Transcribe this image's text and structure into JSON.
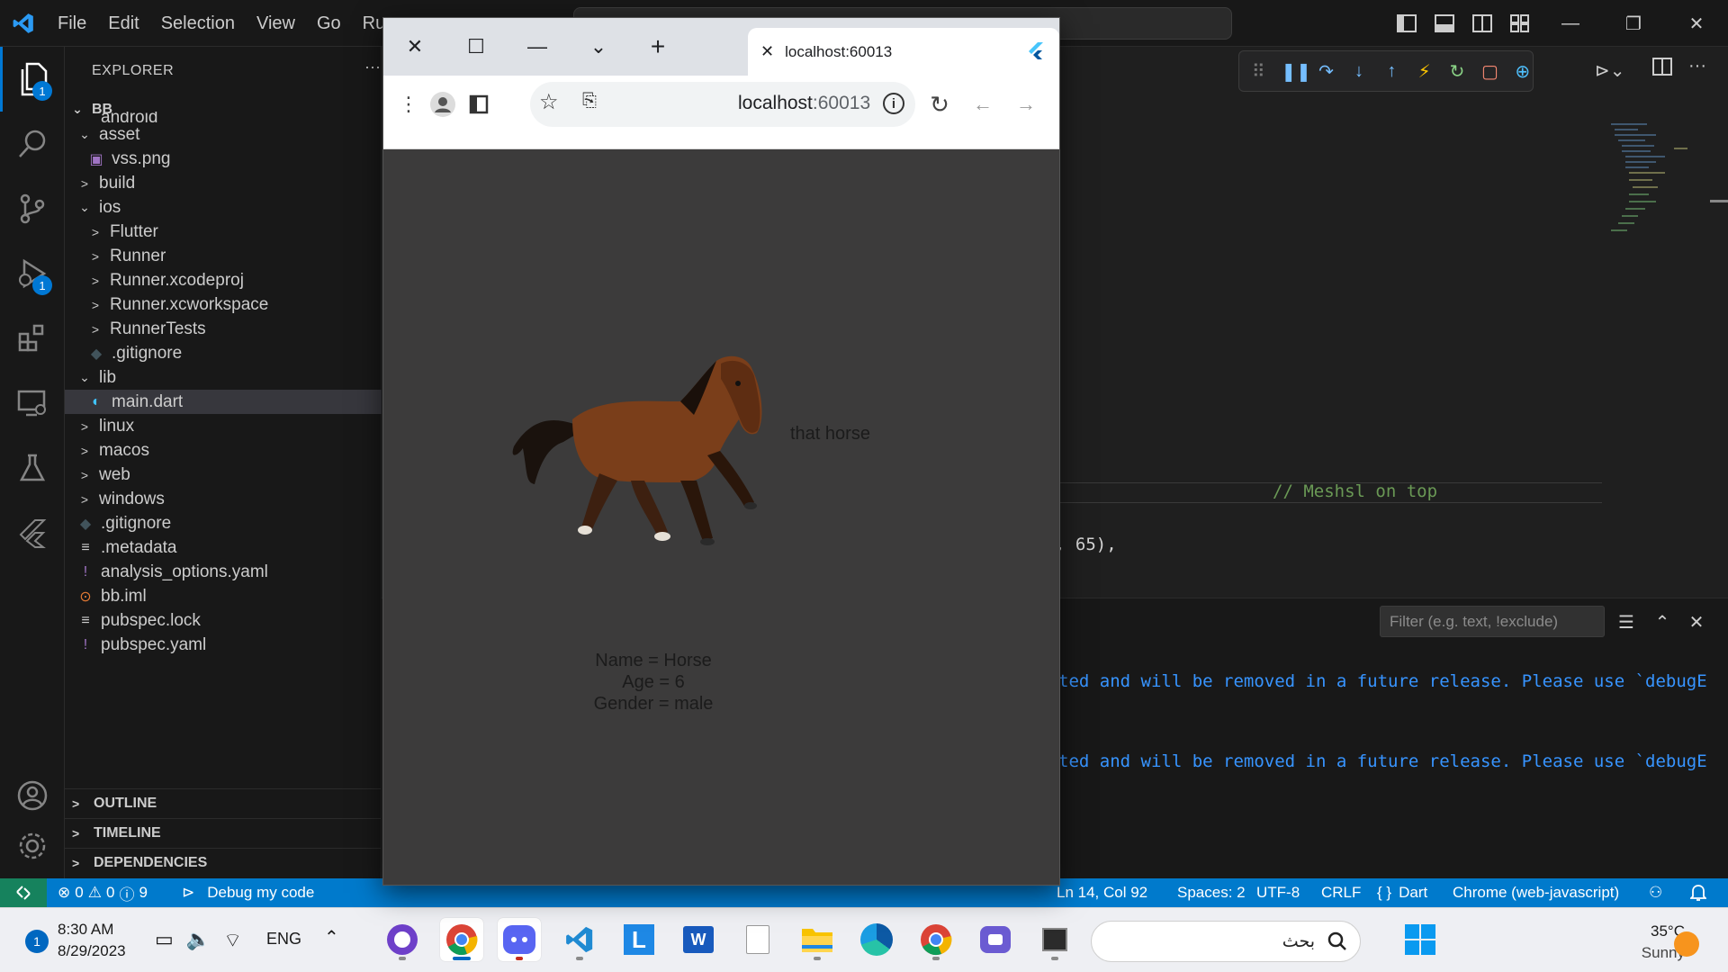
{
  "titlebar": {
    "menu": [
      "File",
      "Edit",
      "Selection",
      "View",
      "Go",
      "Run"
    ]
  },
  "activity": {
    "explorer_badge": "1",
    "debug_badge": "1"
  },
  "explorer": {
    "title": "EXPLORER",
    "more": "···",
    "root": "BB",
    "partial_item": "android",
    "items": [
      {
        "label": "asset",
        "kind": "folder-open",
        "depth": 1
      },
      {
        "label": "vss.png",
        "kind": "image",
        "depth": 2
      },
      {
        "label": "build",
        "kind": "folder",
        "depth": 1
      },
      {
        "label": "ios",
        "kind": "folder-open",
        "depth": 1
      },
      {
        "label": "Flutter",
        "kind": "folder",
        "depth": 2
      },
      {
        "label": "Runner",
        "kind": "folder",
        "depth": 2
      },
      {
        "label": "Runner.xcodeproj",
        "kind": "folder",
        "depth": 2
      },
      {
        "label": "Runner.xcworkspace",
        "kind": "folder",
        "depth": 2
      },
      {
        "label": "RunnerTests",
        "kind": "folder",
        "depth": 2
      },
      {
        "label": ".gitignore",
        "kind": "git",
        "depth": 2
      },
      {
        "label": "lib",
        "kind": "folder-open",
        "depth": 1
      },
      {
        "label": "main.dart",
        "kind": "dart",
        "depth": 2
      },
      {
        "label": "linux",
        "kind": "folder",
        "depth": 1
      },
      {
        "label": "macos",
        "kind": "folder",
        "depth": 1
      },
      {
        "label": "web",
        "kind": "folder",
        "depth": 1
      },
      {
        "label": "windows",
        "kind": "folder",
        "depth": 1
      },
      {
        "label": ".gitignore",
        "kind": "git",
        "depth": 1
      },
      {
        "label": ".metadata",
        "kind": "text",
        "depth": 1
      },
      {
        "label": "analysis_options.yaml",
        "kind": "yaml",
        "depth": 1
      },
      {
        "label": "bb.iml",
        "kind": "rss",
        "depth": 1
      },
      {
        "label": "pubspec.lock",
        "kind": "text",
        "depth": 1
      },
      {
        "label": "pubspec.yaml",
        "kind": "yaml",
        "depth": 1
      }
    ],
    "sections": [
      "OUTLINE",
      "TIMELINE",
      "DEPENDENCIES"
    ]
  },
  "editor": {
    "comment_line": "// Meshsl on top",
    "code_line": ", 65),"
  },
  "panel": {
    "filter_placeholder": "Filter (e.g. text, !exclude)",
    "log_line_1": "ted and will be removed in a future release. Please use `debugE",
    "log_line_2": "ted and will be removed in a future release. Please use `debugE"
  },
  "statusbar": {
    "errors": "0",
    "warnings": "0",
    "infos": "9",
    "debug_label": "Debug my code",
    "position": "Ln 14, Col 92",
    "spaces": "Spaces: 2",
    "encoding": "UTF-8",
    "eol": "CRLF",
    "braces": "{ }",
    "language": "Dart",
    "device": "Chrome (web-javascript)"
  },
  "chrome": {
    "tab_title": "localhost:60013",
    "url_host": "localhost",
    "url_port": ":60013"
  },
  "app": {
    "side_text": "that horse",
    "name_line": "Name = Horse",
    "age_line": "Age = 6",
    "gender_line": "Gender = male"
  },
  "taskbar": {
    "time": "8:30 AM",
    "date": "8/29/2023",
    "notif_badge": "1",
    "language": "ENG",
    "search_text": "بحث",
    "temperature": "35°C",
    "weather": "Sunny",
    "word_label": "W",
    "l_label": "L"
  }
}
